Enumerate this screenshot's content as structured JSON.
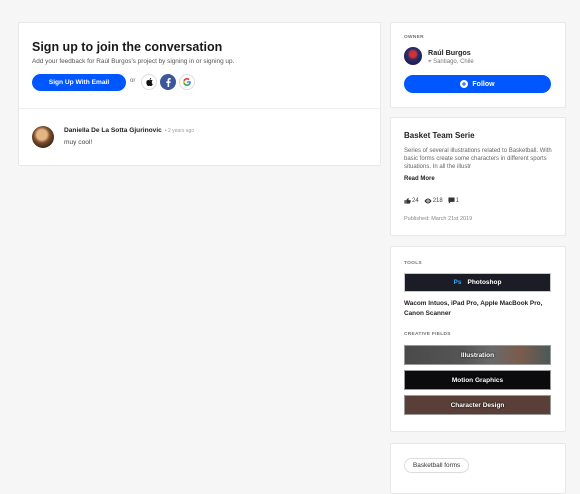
{
  "signup": {
    "title": "Sign up to join the conversation",
    "subtitle": "Add your feedback for Raúl Burgos's project by signing in or signing up.",
    "button_label": "Sign Up With Email",
    "or_text": "or"
  },
  "comment": {
    "author": "Daniella De La Sotta Gjurinovic",
    "time": "• 2 years ago",
    "text": "muy cool!"
  },
  "owner": {
    "label": "OWNER",
    "name": "Raúl Burgos",
    "location": "Santiago, Chile",
    "follow_label": "Follow"
  },
  "project": {
    "title": "Basket Team Serie",
    "description": "Series of several illustrations related to Basketball. With basic forms create some characters in different sports situations. In all the illustr",
    "read_more": "Read More",
    "likes": "24",
    "views": "218",
    "comments": "1",
    "published": "Published: March 21st 2019"
  },
  "tools": {
    "label": "TOOLS",
    "primary_tool": "Photoshop",
    "ps_badge": "Ps",
    "list": "Wacom Intuos, iPad Pro, Apple MacBook Pro, Canon Scanner"
  },
  "creative_fields": {
    "label": "CREATIVE FIELDS",
    "items": [
      "Illustration",
      "Motion Graphics",
      "Character Design"
    ]
  },
  "tags": {
    "items": [
      "Basketball forms"
    ]
  },
  "colors": {
    "accent": "#0057ff",
    "facebook": "#3b5998"
  }
}
